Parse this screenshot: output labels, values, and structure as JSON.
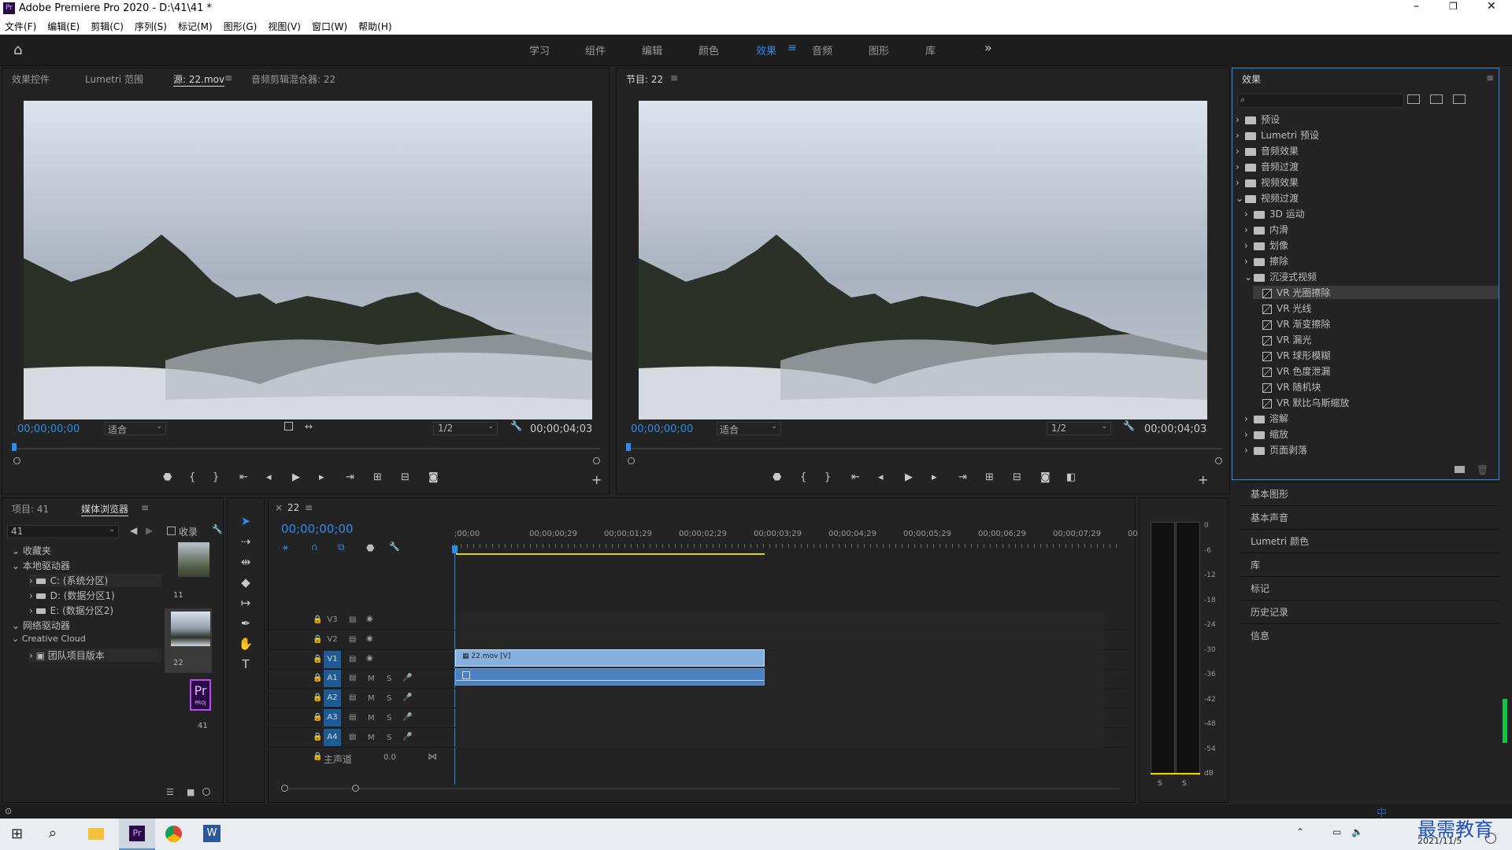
{
  "window": {
    "title": "Adobe Premiere Pro 2020 - D:\\41\\41 *",
    "app_icon": "Pr"
  },
  "menu": [
    "文件(F)",
    "编辑(E)",
    "剪辑(C)",
    "序列(S)",
    "标记(M)",
    "图形(G)",
    "视图(V)",
    "窗口(W)",
    "帮助(H)"
  ],
  "workspaces": {
    "items": [
      "学习",
      "组件",
      "编辑",
      "颜色",
      "效果",
      "音频",
      "图形",
      "库"
    ],
    "active": "效果",
    "more": "»"
  },
  "source_panel": {
    "tabs": [
      "效果控件",
      "Lumetri 范围",
      "源: 22.mov",
      "音频剪辑混合器: 22"
    ],
    "timecode": "00;00;00;00",
    "fit": "适合",
    "resolution": "1/2",
    "duration": "00;00;04;03"
  },
  "program_panel": {
    "tab": "节目: 22",
    "timecode": "00;00;00;00",
    "fit": "适合",
    "resolution": "1/2",
    "duration": "00;00;04;03"
  },
  "effects_panel": {
    "title": "效果",
    "tree": [
      {
        "label": "预设",
        "level": 0,
        "type": "folder",
        "open": false
      },
      {
        "label": "Lumetri 预设",
        "level": 0,
        "type": "folder",
        "open": false
      },
      {
        "label": "音频效果",
        "level": 0,
        "type": "folder",
        "open": false
      },
      {
        "label": "音频过渡",
        "level": 0,
        "type": "folder",
        "open": false
      },
      {
        "label": "视频效果",
        "level": 0,
        "type": "folder",
        "open": false
      },
      {
        "label": "视频过渡",
        "level": 0,
        "type": "folder",
        "open": true
      },
      {
        "label": "3D 运动",
        "level": 1,
        "type": "folder",
        "open": false
      },
      {
        "label": "内滑",
        "level": 1,
        "type": "folder",
        "open": false
      },
      {
        "label": "划像",
        "level": 1,
        "type": "folder",
        "open": false
      },
      {
        "label": "擦除",
        "level": 1,
        "type": "folder",
        "open": false
      },
      {
        "label": "沉浸式视频",
        "level": 1,
        "type": "folder",
        "open": true
      },
      {
        "label": "VR 光圈擦除",
        "level": 2,
        "type": "fx",
        "selected": true
      },
      {
        "label": "VR 光线",
        "level": 2,
        "type": "fx"
      },
      {
        "label": "VR 渐变擦除",
        "level": 2,
        "type": "fx"
      },
      {
        "label": "VR 漏光",
        "level": 2,
        "type": "fx"
      },
      {
        "label": "VR 球形模糊",
        "level": 2,
        "type": "fx"
      },
      {
        "label": "VR 色度泄漏",
        "level": 2,
        "type": "fx"
      },
      {
        "label": "VR 随机块",
        "level": 2,
        "type": "fx"
      },
      {
        "label": "VR 默比乌斯缩放",
        "level": 2,
        "type": "fx"
      },
      {
        "label": "溶解",
        "level": 1,
        "type": "folder",
        "open": false
      },
      {
        "label": "缩放",
        "level": 1,
        "type": "folder",
        "open": false
      },
      {
        "label": "页面剥落",
        "level": 1,
        "type": "folder",
        "open": false
      }
    ]
  },
  "side_panels": [
    "基本图形",
    "基本声音",
    "Lumetri 颜色",
    "库",
    "标记",
    "历史记录",
    "信息"
  ],
  "project_panel": {
    "tabs": [
      "项目: 41",
      "媒体浏览器"
    ],
    "location": "41",
    "favorites_label": "收录",
    "tree": [
      "收藏夹",
      "本地驱动器",
      "C: (系统分区)",
      "D: (数据分区1)",
      "E: (数据分区2)",
      "网络驱动器",
      "Creative Cloud",
      "团队项目版本"
    ],
    "thumbs": [
      "11",
      "22",
      "41"
    ],
    "pr_badge": "Pr",
    "pr_sub": "PROJ"
  },
  "timeline": {
    "tab": "22",
    "timecode": "00;00;00;00",
    "ruler": [
      ";00;00",
      "00;00;00;29",
      "00;00;01;29",
      "00;00;02;29",
      "00;00;03;29",
      "00;00;04;29",
      "00;00;05;29",
      "00;00;06;29",
      "00;00;07;29",
      "00;"
    ],
    "video_tracks": [
      "V3",
      "V2",
      "V1"
    ],
    "audio_tracks": [
      "A1",
      "A2",
      "A3",
      "A4"
    ],
    "master": "主声道",
    "master_value": "0.0",
    "clip_label": "22.mov [V]",
    "m": "M",
    "s": "S"
  },
  "meter": {
    "scale": [
      "0",
      "-6",
      "-12",
      "-18",
      "-24",
      "-30",
      "-36",
      "-42",
      "-48",
      "-54",
      "dB"
    ],
    "solo": [
      "S",
      "S"
    ]
  },
  "taskbar": {
    "date": "2021/11/5",
    "ime": "中",
    "watermark": "最需教育"
  }
}
